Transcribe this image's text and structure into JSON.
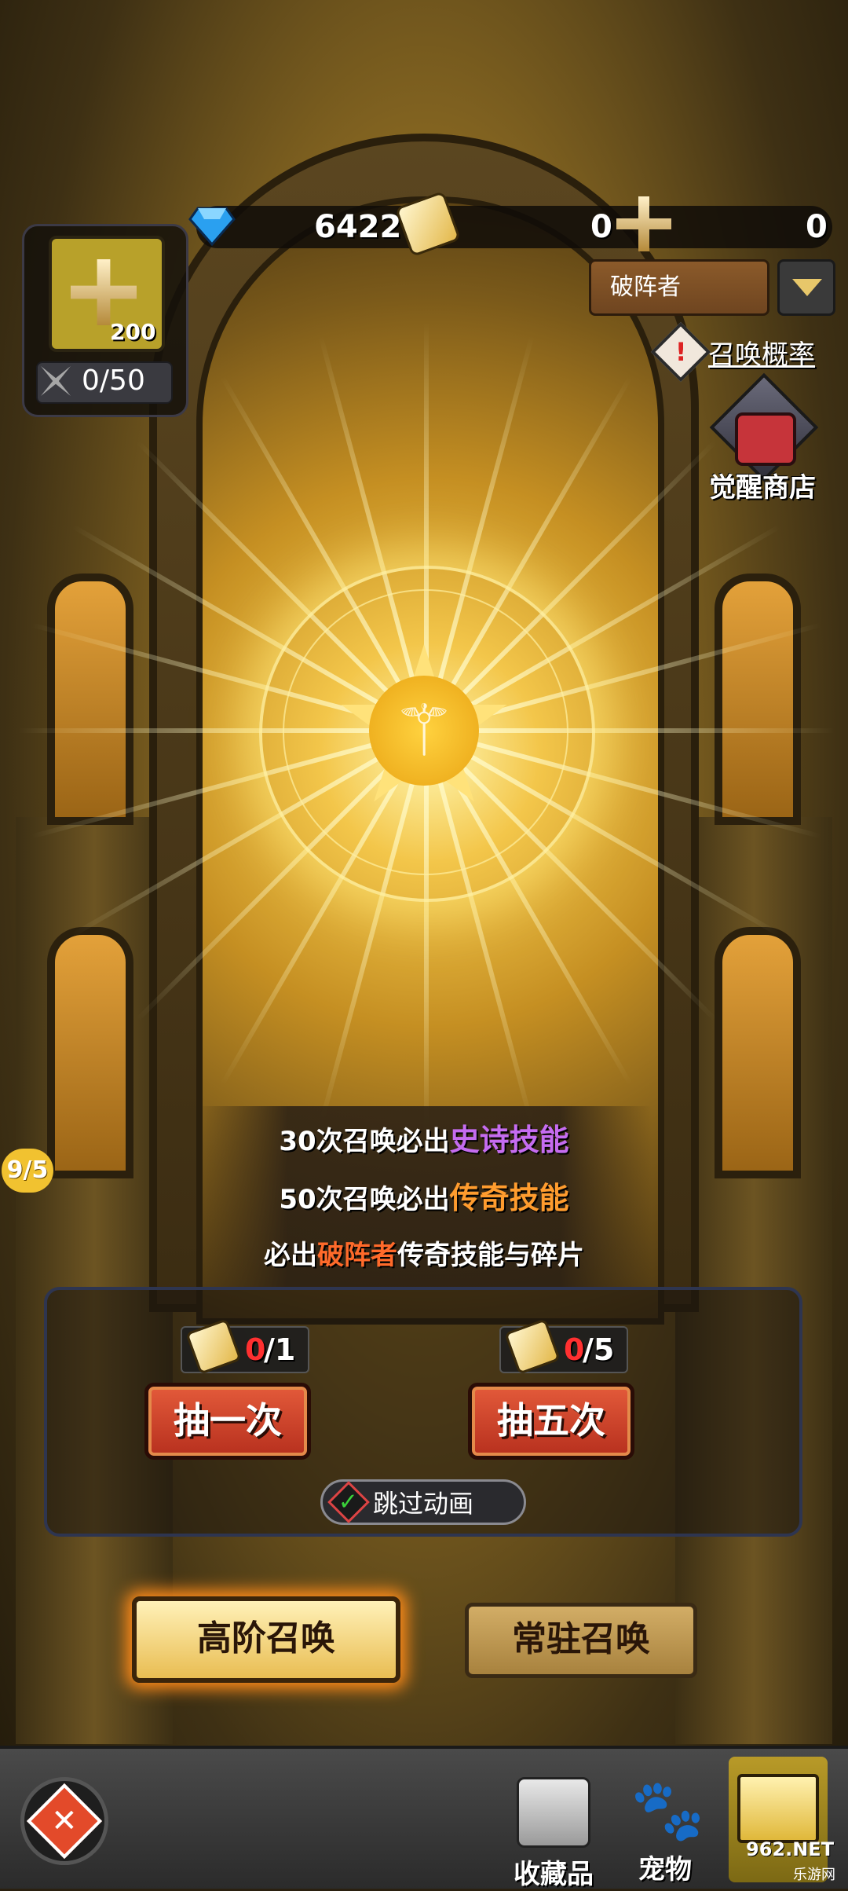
{
  "currency": {
    "gems": "6422",
    "scrolls": "0",
    "crosses": "0"
  },
  "awaken_card": {
    "count": "200",
    "fragments": "0/50"
  },
  "hero_select": {
    "selected": "破阵者"
  },
  "links": {
    "probability": "召唤概率",
    "awaken_shop": "觉醒商店"
  },
  "pity_badge": "9/5",
  "info": {
    "line1_prefix": "30次召唤必出",
    "line1_highlight": "史诗技能",
    "line2_prefix": "50次召唤必出",
    "line2_highlight": "传奇技能",
    "line3_prefix": "必出",
    "line3_highlight": "破阵者",
    "line3_suffix": "传奇技能与碎片"
  },
  "summon": {
    "single_cost_have": "0",
    "single_cost_need": "/1",
    "single_label": "抽一次",
    "five_cost_have": "0",
    "five_cost_need": "/5",
    "five_label": "抽五次",
    "skip_label": "跳过动画"
  },
  "modes": {
    "advanced": "高阶召唤",
    "standard": "常驻召唤"
  },
  "nav": {
    "collection": "收藏品",
    "pets": "宠物"
  },
  "watermark": {
    "brand": "962.NET",
    "sub": "乐游网"
  },
  "colors": {
    "epic": "#c56cf0",
    "legend": "#ff9c2e",
    "pull_button": "#c93a24",
    "active_tab_glow": "#ff8c1a"
  }
}
